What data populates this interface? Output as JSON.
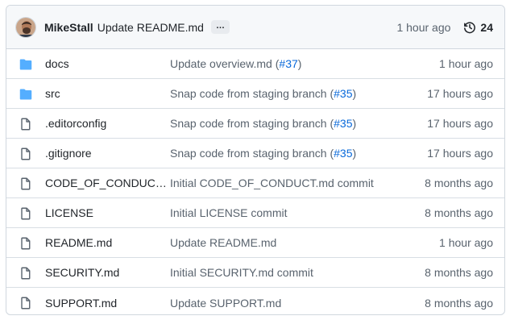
{
  "commit": {
    "author": "MikeStall",
    "message": "Update README.md",
    "ellipsis": "…",
    "time": "1 hour ago",
    "history_count": "24"
  },
  "files": [
    {
      "type": "folder",
      "icon": "folder-icon",
      "name": "docs",
      "msg_pre": "Update overview.md (",
      "pr": "#37",
      "msg_post": ")",
      "time": "1 hour ago"
    },
    {
      "type": "folder",
      "icon": "folder-icon",
      "name": "src",
      "msg_pre": "Snap code from staging branch (",
      "pr": "#35",
      "msg_post": ")",
      "time": "17 hours ago"
    },
    {
      "type": "file",
      "icon": "file-icon",
      "name": ".editorconfig",
      "msg_pre": "Snap code from staging branch (",
      "pr": "#35",
      "msg_post": ")",
      "time": "17 hours ago"
    },
    {
      "type": "file",
      "icon": "file-icon",
      "name": ".gitignore",
      "msg_pre": "Snap code from staging branch (",
      "pr": "#35",
      "msg_post": ")",
      "time": "17 hours ago"
    },
    {
      "type": "file",
      "icon": "file-icon",
      "name": "CODE_OF_CONDUC…",
      "msg_pre": "Initial CODE_OF_CONDUCT.md commit",
      "pr": "",
      "msg_post": "",
      "time": "8 months ago"
    },
    {
      "type": "file",
      "icon": "file-icon",
      "name": "LICENSE",
      "msg_pre": "Initial LICENSE commit",
      "pr": "",
      "msg_post": "",
      "time": "8 months ago"
    },
    {
      "type": "file",
      "icon": "file-icon",
      "name": "README.md",
      "msg_pre": "Update README.md",
      "pr": "",
      "msg_post": "",
      "time": "1 hour ago"
    },
    {
      "type": "file",
      "icon": "file-icon",
      "name": "SECURITY.md",
      "msg_pre": "Initial SECURITY.md commit",
      "pr": "",
      "msg_post": "",
      "time": "8 months ago"
    },
    {
      "type": "file",
      "icon": "file-icon",
      "name": "SUPPORT.md",
      "msg_pre": "Update SUPPORT.md",
      "pr": "",
      "msg_post": "",
      "time": "8 months ago"
    }
  ],
  "colors": {
    "folder": "#54aeff",
    "file_icon": "#59636e",
    "link": "#0969da",
    "muted": "#59636e",
    "border": "#d0d7de"
  }
}
